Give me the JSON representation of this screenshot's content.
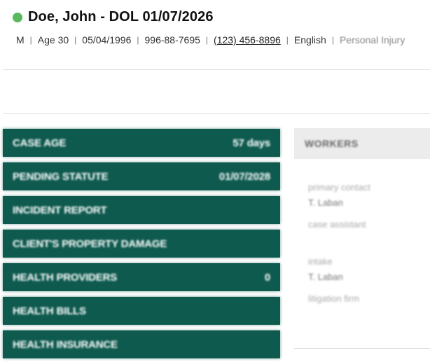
{
  "patient": {
    "title": "Doe, John - DOL 01/07/2026",
    "status_color": "#5cb85c",
    "sex": "M",
    "age": "Age 30",
    "dob": "05/04/1996",
    "ssn": "996-88-7695",
    "phone": "(123) 456-8896",
    "language": "English",
    "case_type": "Personal Injury"
  },
  "panels": [
    {
      "label": "CASE AGE",
      "value": "57 days"
    },
    {
      "label": "PENDING STATUTE",
      "value": "01/07/2028"
    },
    {
      "label": "INCIDENT REPORT",
      "value": ""
    },
    {
      "label": "CLIENT'S PROPERTY DAMAGE",
      "value": ""
    },
    {
      "label": "HEALTH PROVIDERS",
      "value": "0"
    },
    {
      "label": "HEALTH BILLS",
      "value": ""
    },
    {
      "label": "HEALTH INSURANCE",
      "value": ""
    }
  ],
  "panel_color": "#0f5a4f",
  "workers": {
    "heading": "WORKERS",
    "primary_contact_label": "primary contact",
    "primary_contact_value": "T. Laban",
    "case_assistant_label": "case assistant",
    "intake_label": "intake",
    "intake_value": "T. Laban",
    "litigation_firm_label": "litigation firm"
  }
}
